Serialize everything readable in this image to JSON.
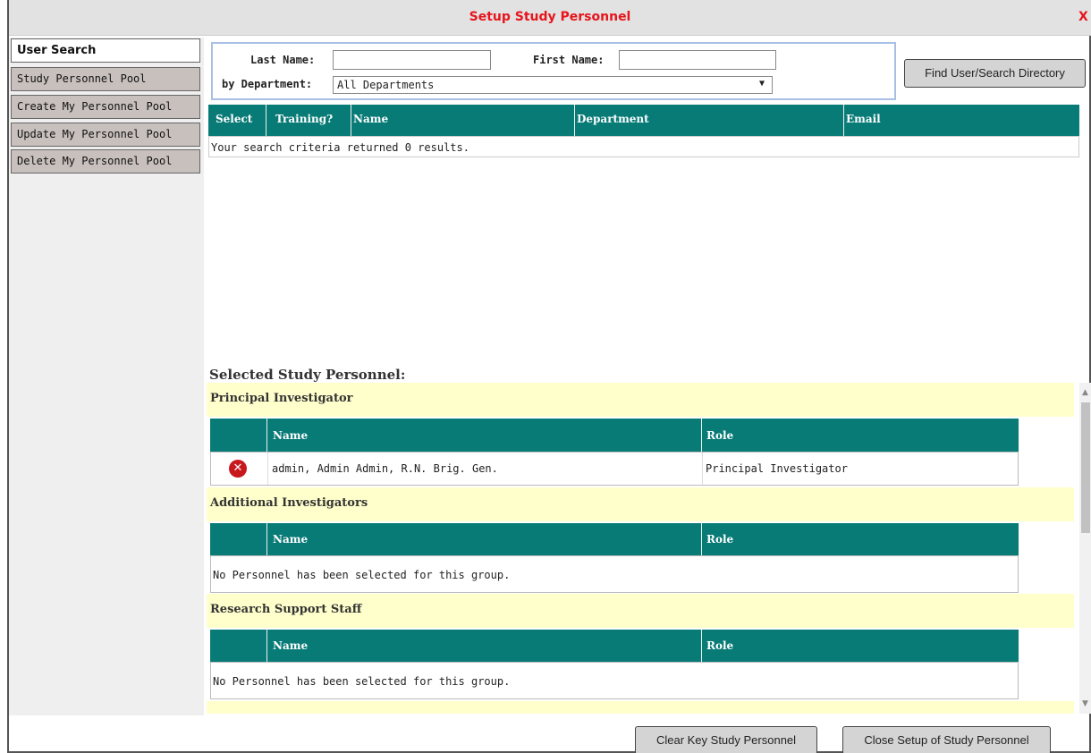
{
  "dialog": {
    "title": "Setup Study Personnel",
    "close_label": "X"
  },
  "sidebar": {
    "items": [
      {
        "label": "User Search",
        "active": true
      },
      {
        "label": "Study Personnel Pool"
      },
      {
        "label": "Create My Personnel Pool"
      },
      {
        "label": "Update My Personnel Pool"
      },
      {
        "label": "Delete My Personnel Pool"
      }
    ]
  },
  "search": {
    "last_name_label": "Last Name:",
    "last_name_value": "",
    "first_name_label": "First Name:",
    "first_name_value": "",
    "department_label": "by Department:",
    "department_value": "All Departments",
    "find_button": "Find User/Search Directory"
  },
  "results": {
    "columns": [
      "Select",
      "Training?",
      "Name",
      "Department",
      "Email"
    ],
    "empty_message": "Your search criteria returned 0 results."
  },
  "selected": {
    "heading": "Selected Study Personnel:",
    "groups": [
      {
        "title": "Principal Investigator",
        "columns": [
          "Name",
          "Role"
        ],
        "rows": [
          {
            "name": "admin, Admin Admin, R.N. Brig. Gen.",
            "role": "Principal Investigator"
          }
        ]
      },
      {
        "title": "Additional Investigators",
        "columns": [
          "Name",
          "Role"
        ],
        "empty_message": "No Personnel has been selected for this group."
      },
      {
        "title": "Research Support Staff",
        "columns": [
          "Name",
          "Role"
        ],
        "empty_message": "No Personnel has been selected for this group."
      }
    ]
  },
  "footer": {
    "clear_button": "Clear Key Study Personnel",
    "close_button": "Close Setup of Study Personnel"
  },
  "icons": {
    "remove": "remove-circle-icon"
  },
  "colors": {
    "title": "#e8141b",
    "header": "#087b77",
    "group_band": "#ffffcc",
    "search_border": "#a9c0e4"
  }
}
